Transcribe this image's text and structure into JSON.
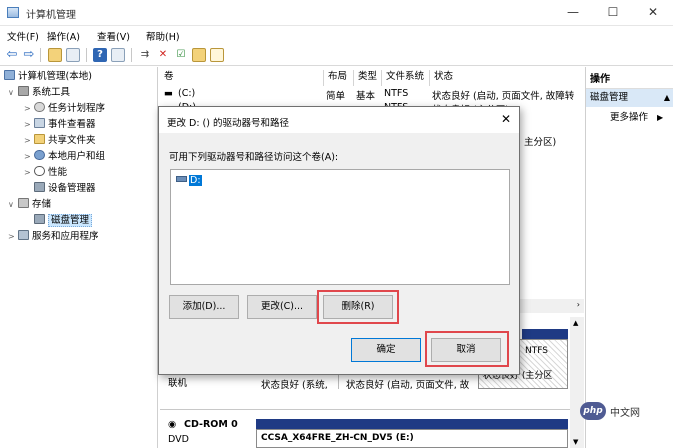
{
  "window": {
    "title": "计算机管理",
    "min": "—",
    "max": "☐",
    "close": "✕"
  },
  "menu": [
    "文件(F)",
    "操作(A)",
    "查看(V)",
    "帮助(H)"
  ],
  "toolbar": {
    "back_icon": "arrow-left-icon",
    "forward_icon": "arrow-right-icon",
    "delete_glyph": "✕"
  },
  "tree": {
    "root": "计算机管理(本地)",
    "system_tools": "系统工具",
    "task_scheduler": "任务计划程序",
    "event_viewer": "事件查看器",
    "shared_folders": "共享文件夹",
    "local_users": "本地用户和组",
    "performance": "性能",
    "device_manager": "设备管理器",
    "storage": "存储",
    "disk_management": "磁盘管理",
    "services": "服务和应用程序"
  },
  "volumes": {
    "headers": [
      "卷",
      "布局",
      "类型",
      "文件系统",
      "状态"
    ],
    "rows": [
      [
        "(C:)",
        "简单",
        "基本",
        "NTFS",
        "状态良好 (启动, 页面文件, 故障转"
      ],
      [
        "(D:)",
        "简单",
        "基本",
        "NTFS",
        "状态良好 (主分区)"
      ]
    ],
    "row3_tail": "主分区)"
  },
  "disk_map": {
    "online_label": "联机",
    "seg1_status": "状态良好 (系统,",
    "seg2_status": "状态良好 (启动, 页面文件, 故",
    "seg3_fs": "NTFS",
    "seg3_status": "状态良好 (主分区",
    "cdrom_label": "CD-ROM 0",
    "cdrom_type": "DVD",
    "cdrom_volume": "CCSA_X64FRE_ZH-CN_DV5 (E:)"
  },
  "actions": {
    "header": "操作",
    "section": "磁盘管理",
    "more": "更多操作"
  },
  "dialog": {
    "title": "更改 D: () 的驱动器号和路径",
    "close": "✕",
    "prompt": "可用下列驱动器号和路径访问这个卷(A):",
    "entries": [
      "D:"
    ],
    "add": "添加(D)...",
    "change": "更改(C)...",
    "remove": "删除(R)",
    "ok": "确定",
    "cancel": "取消"
  },
  "watermark": "php 中文网",
  "colors": {
    "highlight_red": "#e0474c",
    "selection_blue": "#0078d7",
    "disk_bar_navy": "#1f3a84"
  }
}
